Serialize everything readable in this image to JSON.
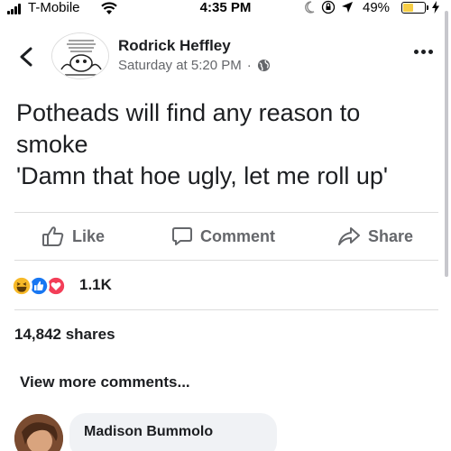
{
  "status_bar": {
    "carrier": "T-Mobile",
    "time": "4:35 PM",
    "battery_percent": "49%",
    "battery_level": 0.49,
    "battery_color": "#f7ce46"
  },
  "post": {
    "author": "Rodrick Heffley",
    "timestamp": "Saturday at 5:20 PM",
    "separator": "·",
    "audience_icon": "globe-icon",
    "text_lines": [
      "Potheads will find any reason to",
      "smoke",
      "'Damn that hoe ugly, let me roll up'"
    ],
    "actions": {
      "like": "Like",
      "comment": "Comment",
      "share": "Share"
    },
    "reactions": {
      "icons": [
        "haha-icon",
        "like-icon",
        "love-icon"
      ],
      "count": "1.1K"
    },
    "shares": "14,842 shares",
    "view_more": "View more comments..."
  },
  "comment": {
    "author": "Madison Bummolo"
  },
  "colors": {
    "text": "#1c1e21",
    "secondary": "#65676b",
    "like_blue": "#1877f2",
    "love_red": "#f33e58",
    "haha_yellow": "#f7b928",
    "bubble": "#f0f2f5"
  }
}
